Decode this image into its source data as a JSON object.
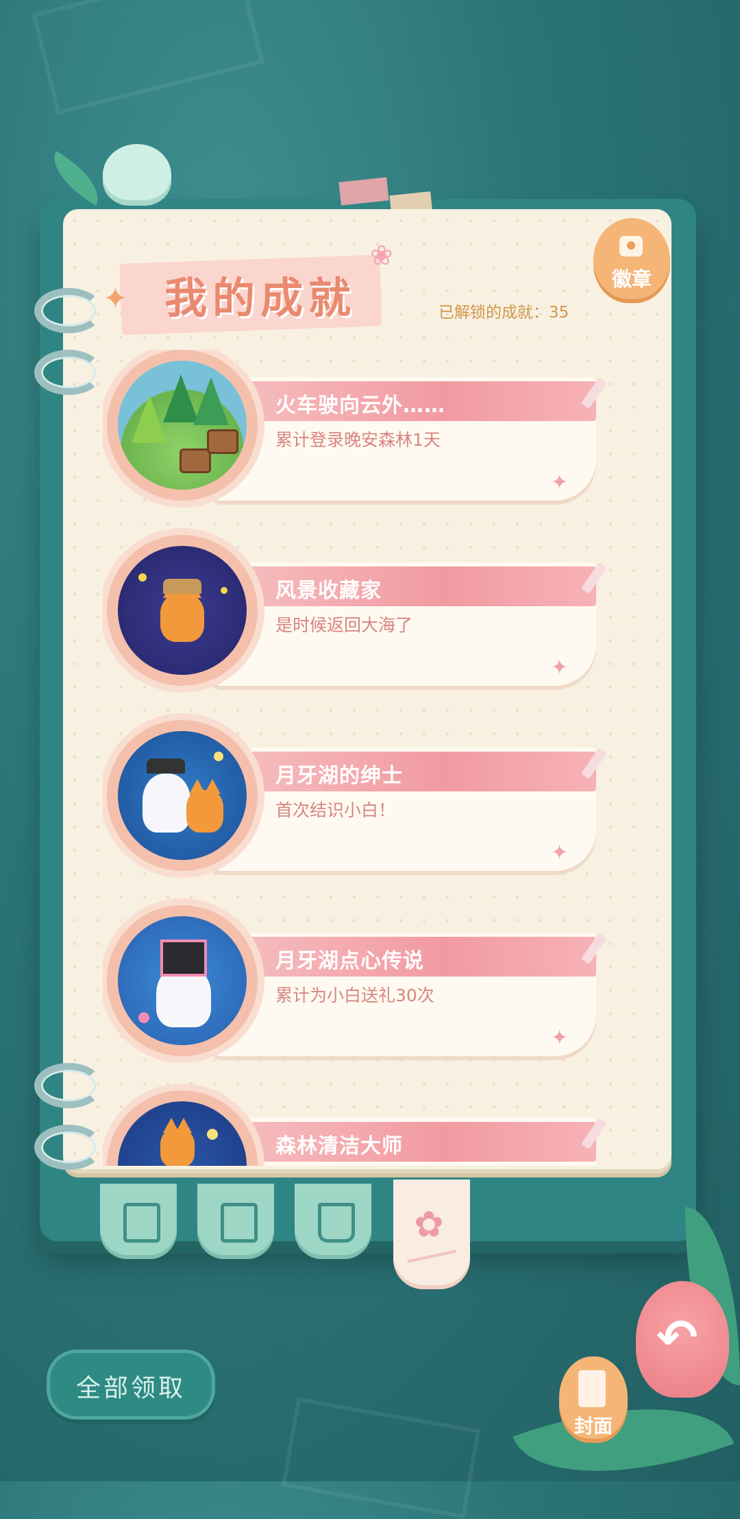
{
  "header": {
    "title": "我的成就",
    "unlocked_label": "已解锁的成就：35"
  },
  "badge_button": {
    "label": "徽章",
    "icon": "flower-icon"
  },
  "achievements": [
    {
      "name": "火车驶向云外……",
      "description": "累计登录晚安森林1天",
      "medal_icon": "forest-medal-icon"
    },
    {
      "name": "风景收藏家",
      "description": "是时候返回大海了",
      "medal_icon": "fox-explorer-medal-icon"
    },
    {
      "name": "月牙湖的绅士",
      "description": "首次结识小白！",
      "medal_icon": "ghost-gentleman-medal-icon"
    },
    {
      "name": "月牙湖点心传说",
      "description": "累计为小白送礼30次",
      "medal_icon": "gift-ghost-medal-icon"
    },
    {
      "name": "森林清洁大师",
      "description": "",
      "medal_icon": "fox-cleaner-medal-icon"
    }
  ],
  "tabs": [
    {
      "icon": "notes-edit-icon"
    },
    {
      "icon": "photo-journal-icon"
    },
    {
      "icon": "open-book-star-icon"
    },
    {
      "icon": "flower-badge-icon",
      "active": true
    }
  ],
  "footer": {
    "claim_all_label": "全部领取",
    "cover_label": "封面",
    "back_icon": "undo-arrow-icon"
  },
  "colors": {
    "background": "#2b7476",
    "banner": "#f29aa2",
    "accent_orange": "#f5b577",
    "title": "#e98a6f"
  }
}
